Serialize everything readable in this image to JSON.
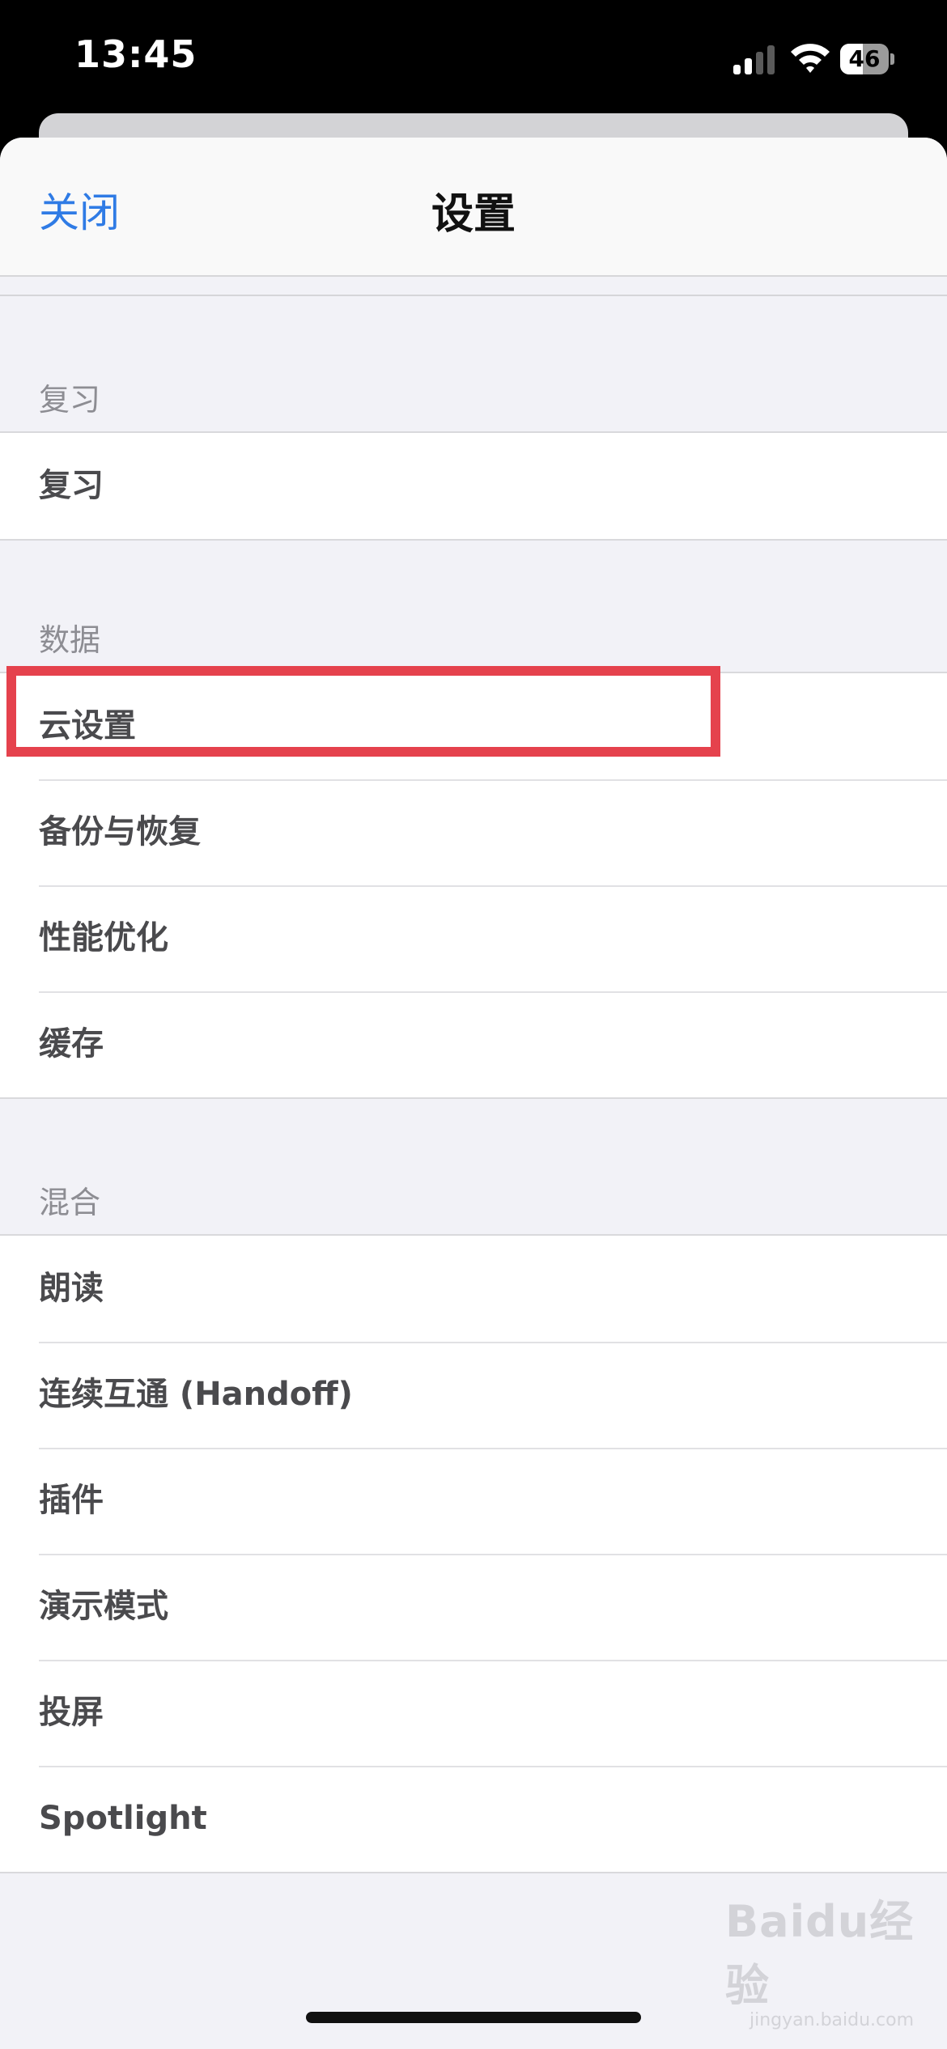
{
  "status_bar": {
    "time": "13:45",
    "battery": "46",
    "battery_level": 0.46
  },
  "nav": {
    "close_label": "关闭",
    "title": "设置"
  },
  "sections": [
    {
      "header": "复习",
      "items": [
        "复习"
      ]
    },
    {
      "header": "数据",
      "items": [
        "云设置",
        "备份与恢复",
        "性能优化",
        "缓存"
      ]
    },
    {
      "header": "混合",
      "items": [
        "朗读",
        "连续互通 (Handoff)",
        "插件",
        "演示模式",
        "投屏",
        "Spotlight"
      ]
    }
  ],
  "highlighted_item": "云设置",
  "watermark": {
    "text": "Baidu经验",
    "sub": "jingyan.baidu.com"
  },
  "colors": {
    "accent": "#2f7be5",
    "highlight": "#e5424d",
    "background": "#f2f2f7"
  }
}
